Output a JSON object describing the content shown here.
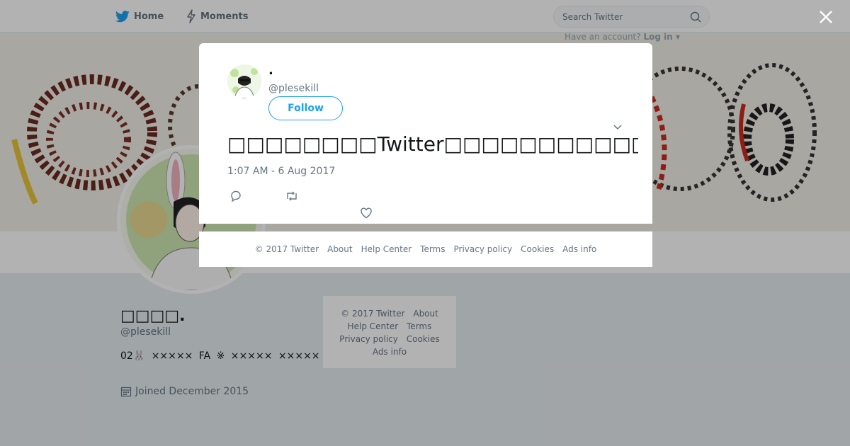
{
  "topbar": {
    "home_label": "Home",
    "moments_label": "Moments",
    "search_placeholder": "Search Twitter",
    "have_account": "Have an account?",
    "login_label": "Log in"
  },
  "profile": {
    "name": "□□□□.",
    "handle": "@plesekill",
    "bio": "02🐰 ××××× FA ※ ××××× ×××××",
    "joined": "Joined December 2015"
  },
  "side_footer": {
    "links": [
      "© 2017 Twitter",
      "About",
      "Help Center",
      "Terms",
      "Privacy policy",
      "Cookies",
      "Ads info"
    ]
  },
  "tweet": {
    "name": ".",
    "handle": "@plesekill",
    "follow_label": "Follow",
    "text": "□□□□□□□□Twitter□□□□□□□□□□□□□□□□□□□□□",
    "time": "1:07 AM - 6 Aug 2017"
  },
  "modal_footer": {
    "links": [
      "© 2017 Twitter",
      "About",
      "Help Center",
      "Terms",
      "Privacy policy",
      "Cookies",
      "Ads info"
    ]
  },
  "colors": {
    "accent": "#1da1f2",
    "muted": "#657786",
    "background": "#e6ecf0"
  }
}
